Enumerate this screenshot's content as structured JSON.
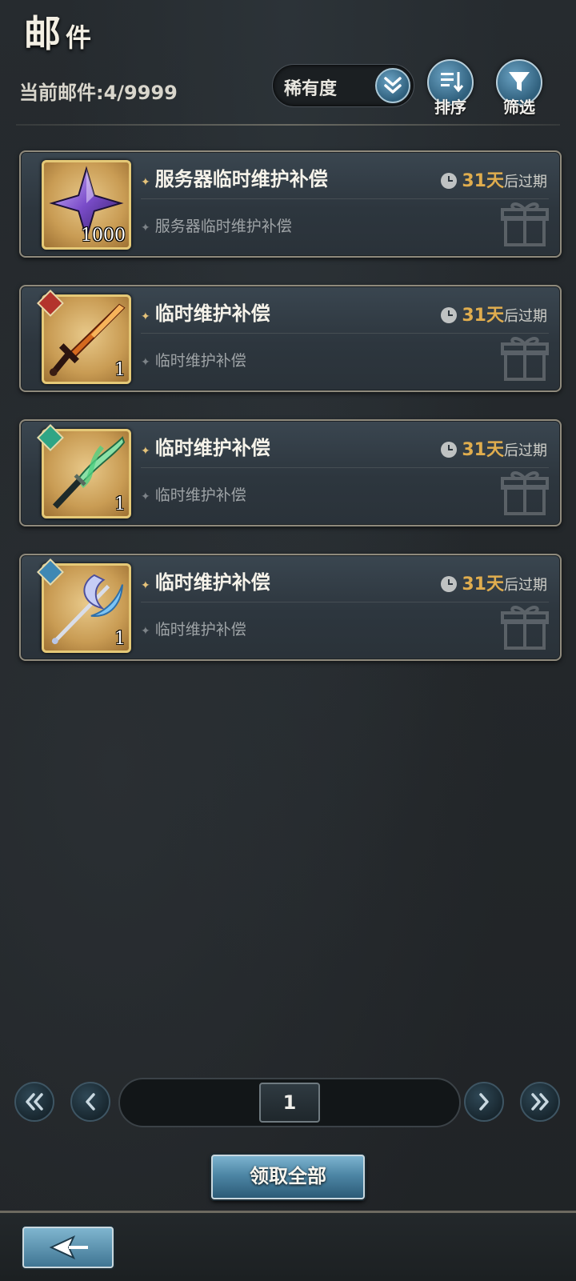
{
  "header": {
    "title_main": "邮",
    "title_sub": "件",
    "mail_count": "当前邮件:4/9999"
  },
  "toolbar": {
    "sort_selected": "稀有度",
    "sort_button_label": "排序",
    "filter_button_label": "筛选"
  },
  "mails": [
    {
      "title": "服务器临时维护补偿",
      "subtitle": "服务器临时维护补偿",
      "days": "31天",
      "expire_suffix": "后过期",
      "item_qty": "1000",
      "item_icon": "purple-star-crystal-icon"
    },
    {
      "title": "临时维护补偿",
      "subtitle": "临时维护补偿",
      "days": "31天",
      "expire_suffix": "后过期",
      "item_qty": "1",
      "item_icon": "flame-sword-icon",
      "element_color": "#b3342c"
    },
    {
      "title": "临时维护补偿",
      "subtitle": "临时维护补偿",
      "days": "31天",
      "expire_suffix": "后过期",
      "item_qty": "1",
      "item_icon": "wind-katana-icon",
      "element_color": "#2fa585"
    },
    {
      "title": "临时维护补偿",
      "subtitle": "临时维护补偿",
      "days": "31天",
      "expire_suffix": "后过期",
      "item_qty": "1",
      "item_icon": "ice-polearm-icon",
      "element_color": "#3f88b4"
    }
  ],
  "pagination": {
    "current_page": "1"
  },
  "actions": {
    "claim_all_label": "领取全部"
  },
  "colors": {
    "accent_gold": "#e0ad4e",
    "button_blue": "#4d86a5"
  }
}
